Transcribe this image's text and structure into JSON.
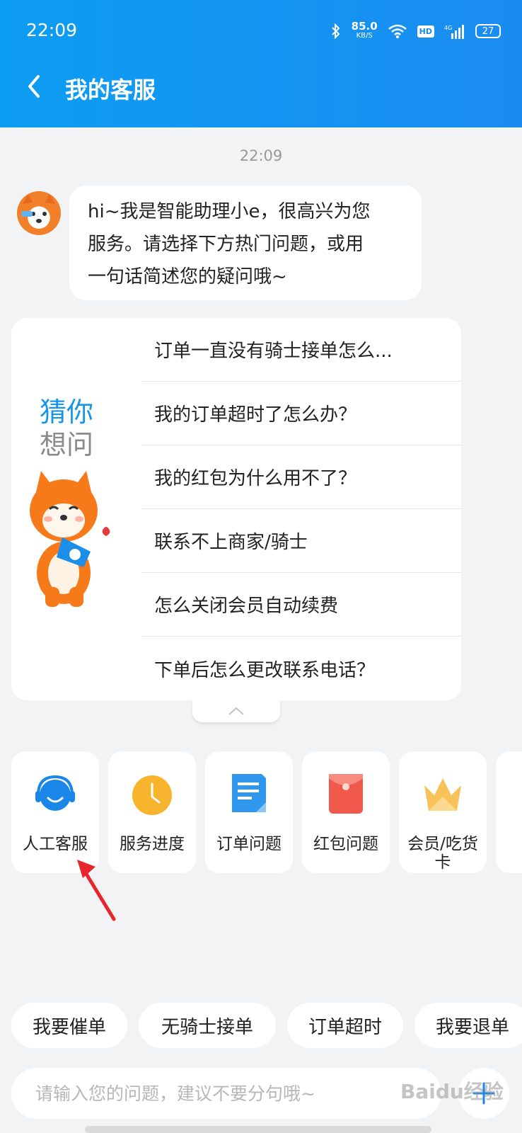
{
  "status_bar": {
    "time": "22:09",
    "net_speed": "85.0",
    "net_unit": "KB/S",
    "hd": "HD",
    "signal": "4G",
    "battery": "27"
  },
  "header": {
    "title": "我的客服"
  },
  "chat": {
    "timestamp": "22:09",
    "greeting_line1": "hi~我是智能助理小e，很高兴为您",
    "greeting_line2": "服务。请选择下方热门问题，或用",
    "greeting_line3": "一句话简述您的疑问哦~"
  },
  "faq": {
    "title_line1": "猜你",
    "title_line2": "想问",
    "items": [
      "订单一直没有骑士接单怎么...",
      "我的订单超时了怎么办？",
      "我的红包为什么用不了？",
      "联系不上商家/骑士",
      "怎么关闭会员自动续费",
      "下单后怎么更改联系电话？"
    ]
  },
  "services": [
    {
      "label": "人工客服",
      "icon": "headset-icon",
      "color": "#1a86e8"
    },
    {
      "label": "服务进度",
      "icon": "clock-icon",
      "color": "#f7b42c"
    },
    {
      "label": "订单问题",
      "icon": "document-icon",
      "color": "#2f98ee"
    },
    {
      "label": "红包问题",
      "icon": "red-envelope-icon",
      "color": "#f2594d"
    },
    {
      "label": "会员/吃货卡",
      "icon": "crown-icon",
      "color": "#f7c25a"
    }
  ],
  "quick_replies": [
    "我要催单",
    "无骑士接单",
    "订单超时",
    "我要退单"
  ],
  "input": {
    "placeholder": "请输入您的问题，建议不要分句哦~"
  },
  "watermark": "Baidu经验"
}
